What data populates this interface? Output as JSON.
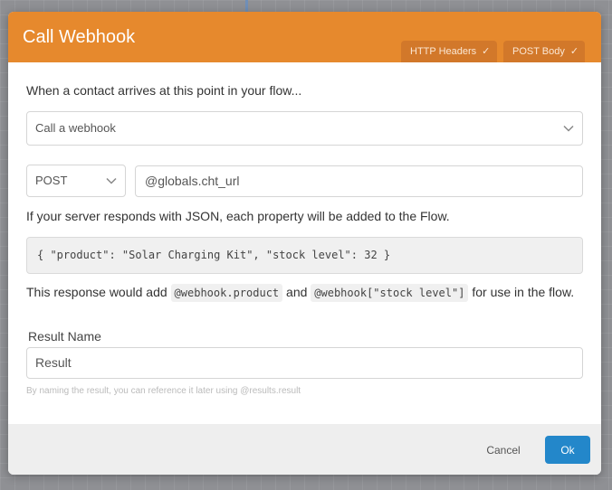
{
  "header": {
    "title": "Call Webhook",
    "tabs": [
      {
        "label": "HTTP Headers",
        "check": "✓"
      },
      {
        "label": "POST Body",
        "check": "✓"
      }
    ]
  },
  "intro": "When a contact arrives at this point in your flow...",
  "action_select": {
    "value": "Call a webhook"
  },
  "method_select": {
    "value": "POST"
  },
  "url_input": {
    "value": "@globals.cht_url"
  },
  "json_info": "If your server responds with JSON, each property will be added to the Flow.",
  "example_json": "{ \"product\": \"Solar Charging Kit\", \"stock level\": 32 }",
  "response": {
    "prefix": "This response would add",
    "code1": "@webhook.product",
    "and": "and",
    "code2": "@webhook[\"stock level\"]",
    "suffix": "for use in the flow."
  },
  "result": {
    "label": "Result Name",
    "value": "Result",
    "help": "By naming the result, you can reference it later using @results.result"
  },
  "footer": {
    "cancel": "Cancel",
    "ok": "Ok"
  },
  "colors": {
    "header": "#e6892d",
    "ok_button": "#2387ca"
  }
}
